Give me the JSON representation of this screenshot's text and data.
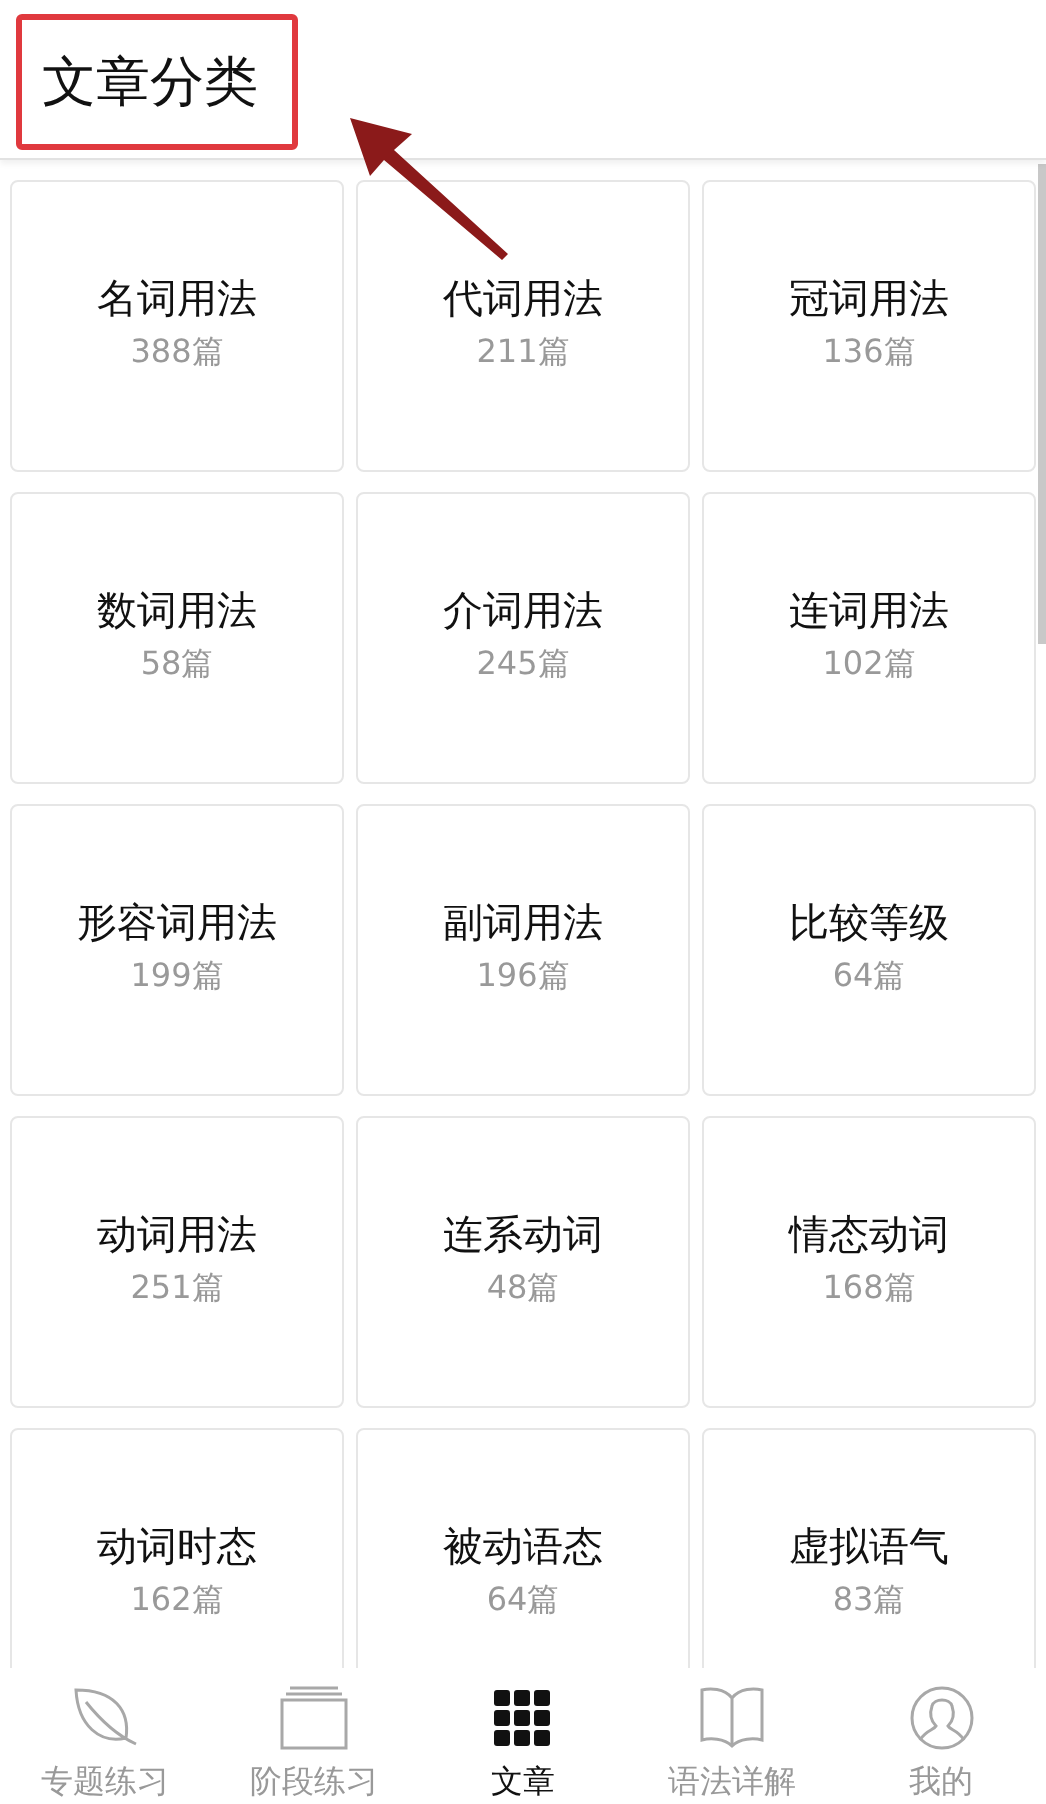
{
  "header": {
    "title": "文章分类"
  },
  "categories": [
    {
      "name": "名词用法",
      "count": "388篇"
    },
    {
      "name": "代词用法",
      "count": "211篇"
    },
    {
      "name": "冠词用法",
      "count": "136篇"
    },
    {
      "name": "数词用法",
      "count": "58篇"
    },
    {
      "name": "介词用法",
      "count": "245篇"
    },
    {
      "name": "连词用法",
      "count": "102篇"
    },
    {
      "name": "形容词用法",
      "count": "199篇"
    },
    {
      "name": "副词用法",
      "count": "196篇"
    },
    {
      "name": "比较等级",
      "count": "64篇"
    },
    {
      "name": "动词用法",
      "count": "251篇"
    },
    {
      "name": "连系动词",
      "count": "48篇"
    },
    {
      "name": "情态动词",
      "count": "168篇"
    },
    {
      "name": "动词时态",
      "count": "162篇"
    },
    {
      "name": "被动语态",
      "count": "64篇"
    },
    {
      "name": "虚拟语气",
      "count": "83篇"
    }
  ],
  "tab_bar": [
    {
      "label": "专题练习",
      "kind": "leaf",
      "selected": false
    },
    {
      "label": "阶段练习",
      "kind": "stack",
      "selected": false
    },
    {
      "label": "文章",
      "kind": "grid",
      "selected": true
    },
    {
      "label": "语法详解",
      "kind": "book",
      "selected": false
    },
    {
      "label": "我的",
      "kind": "user",
      "selected": false
    }
  ]
}
